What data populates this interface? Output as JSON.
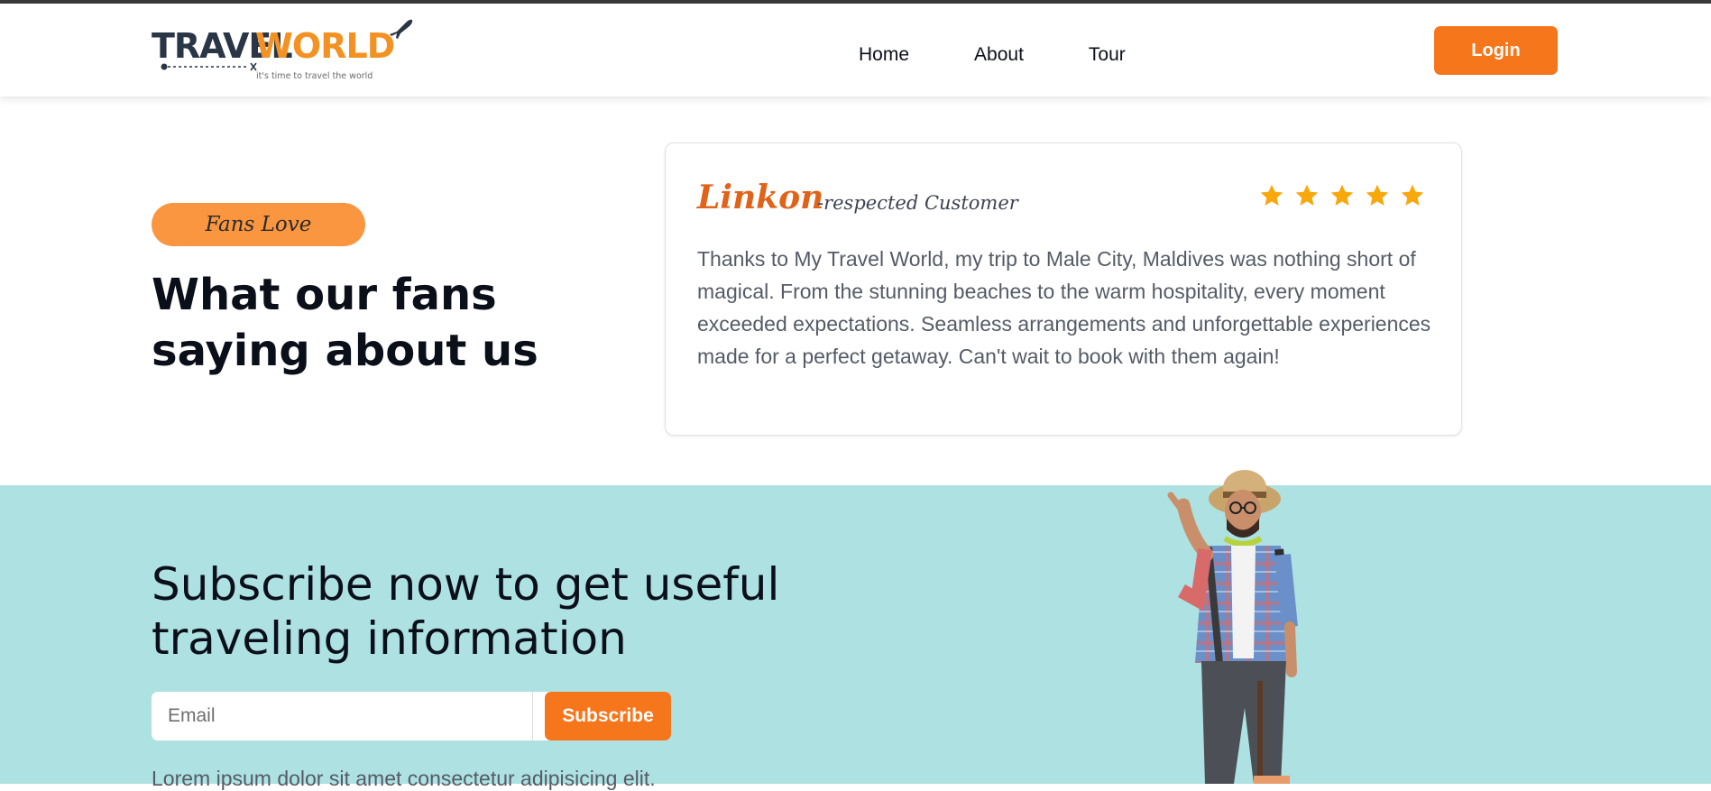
{
  "header": {
    "logo": {
      "word_1": "TRAVEL",
      "word_2": "WORLD",
      "tagline": "it's time to travel the world"
    },
    "nav": [
      {
        "label": "Home"
      },
      {
        "label": "About"
      },
      {
        "label": "Tour"
      }
    ],
    "login_label": "Login"
  },
  "testimonials": {
    "badge": "Fans Love",
    "title": "What our fans saying about us",
    "review": {
      "name": "Linkon",
      "role": "-respected Customer",
      "rating": 5,
      "rating_max": 5,
      "text": "Thanks to My Travel World, my trip to Male City, Maldives was nothing short of magical. From the stunning beaches to the warm hospitality, every moment exceeded expectations. Seamless arrangements and unforgettable experiences made for a perfect getaway. Can't wait to book with them again!"
    }
  },
  "subscribe": {
    "title": "Subscribe now to get useful traveling information",
    "email_placeholder": "Email",
    "button_label": "Subscribe",
    "description": "Lorem ipsum dolor sit amet consectetur adipisicing elit."
  },
  "colors": {
    "accent": "#f6761c",
    "badge": "#fa9640",
    "star": "#f7a80d",
    "subscribe_bg": "#ade1e2",
    "logo_dark": "#2a3646",
    "logo_orange": "#f39222"
  },
  "icons": {
    "logo_plane": "airplane-icon",
    "star": "star-icon"
  }
}
